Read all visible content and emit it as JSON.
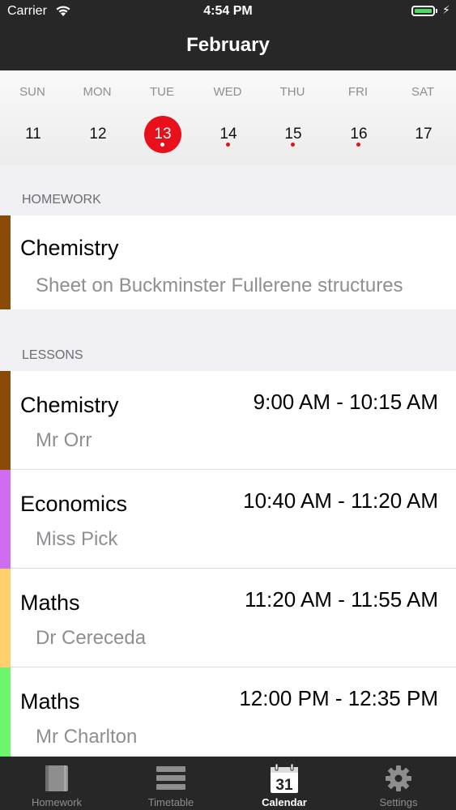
{
  "status_bar": {
    "carrier": "Carrier",
    "time": "4:54 PM"
  },
  "nav": {
    "title": "February"
  },
  "week": {
    "days": [
      {
        "dow": "SUN",
        "num": "11",
        "dot": false,
        "selected": false
      },
      {
        "dow": "MON",
        "num": "12",
        "dot": false,
        "selected": false
      },
      {
        "dow": "TUE",
        "num": "13",
        "dot": true,
        "selected": true
      },
      {
        "dow": "WED",
        "num": "14",
        "dot": true,
        "selected": false
      },
      {
        "dow": "THU",
        "num": "15",
        "dot": true,
        "selected": false
      },
      {
        "dow": "FRI",
        "num": "16",
        "dot": true,
        "selected": false
      },
      {
        "dow": "SAT",
        "num": "17",
        "dot": false,
        "selected": false
      }
    ],
    "accent": "#e8101a"
  },
  "homework": {
    "header": "HOMEWORK",
    "items": [
      {
        "subject": "Chemistry",
        "detail": "Sheet on Buckminster Fullerene structures",
        "color": "#8a4b08"
      }
    ]
  },
  "lessons": {
    "header": "LESSONS",
    "items": [
      {
        "subject": "Chemistry",
        "teacher": "Mr Orr",
        "time": "9:00 AM - 10:15 AM",
        "color": "#8a4b08"
      },
      {
        "subject": "Economics",
        "teacher": "Miss Pick",
        "time": "10:40 AM - 11:20 AM",
        "color": "#cf6cf0"
      },
      {
        "subject": "Maths",
        "teacher": "Dr Cereceda",
        "time": "11:20 AM - 11:55 AM",
        "color": "#ffd06b"
      },
      {
        "subject": "Maths",
        "teacher": "Mr Charlton",
        "time": "12:00 PM - 12:35 PM",
        "color": "#6ef56e"
      }
    ]
  },
  "tabs": [
    {
      "label": "Homework",
      "icon": "book-icon",
      "active": false
    },
    {
      "label": "Timetable",
      "icon": "list-icon",
      "active": false
    },
    {
      "label": "Calendar",
      "icon": "calendar-icon",
      "active": true,
      "icon_text": "31"
    },
    {
      "label": "Settings",
      "icon": "gear-icon",
      "active": false
    }
  ]
}
